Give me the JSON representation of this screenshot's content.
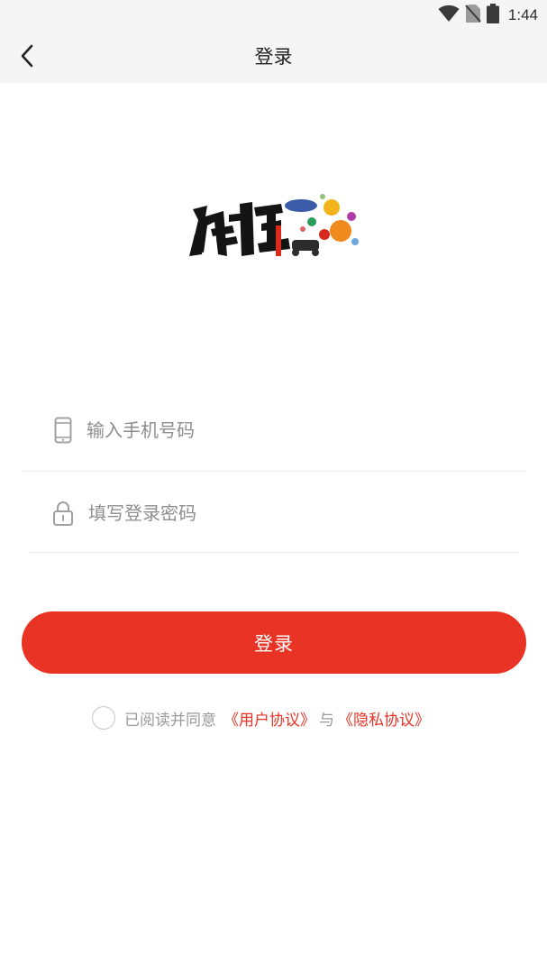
{
  "status_bar": {
    "time": "1:44",
    "icons": [
      "wifi-icon",
      "no-sim-icon",
      "battery-icon"
    ]
  },
  "header": {
    "title": "登录",
    "back_icon": "chevron-left-icon"
  },
  "logo": {
    "text": "疯狂"
  },
  "form": {
    "phone": {
      "icon": "phone-icon",
      "value": "",
      "placeholder": "输入手机号码"
    },
    "password": {
      "icon": "lock-icon",
      "value": "",
      "placeholder": "填写登录密码"
    },
    "submit_label": "登录"
  },
  "agreement": {
    "checked": false,
    "prefix": "已阅读并同意",
    "user_agreement": "《用户协议》",
    "and": "与",
    "privacy_policy": "《隐私协议》"
  },
  "colors": {
    "primary": "#e93324",
    "header_bg": "#f5f5f5",
    "placeholder": "#8e8e8e",
    "divider": "#ececec"
  }
}
